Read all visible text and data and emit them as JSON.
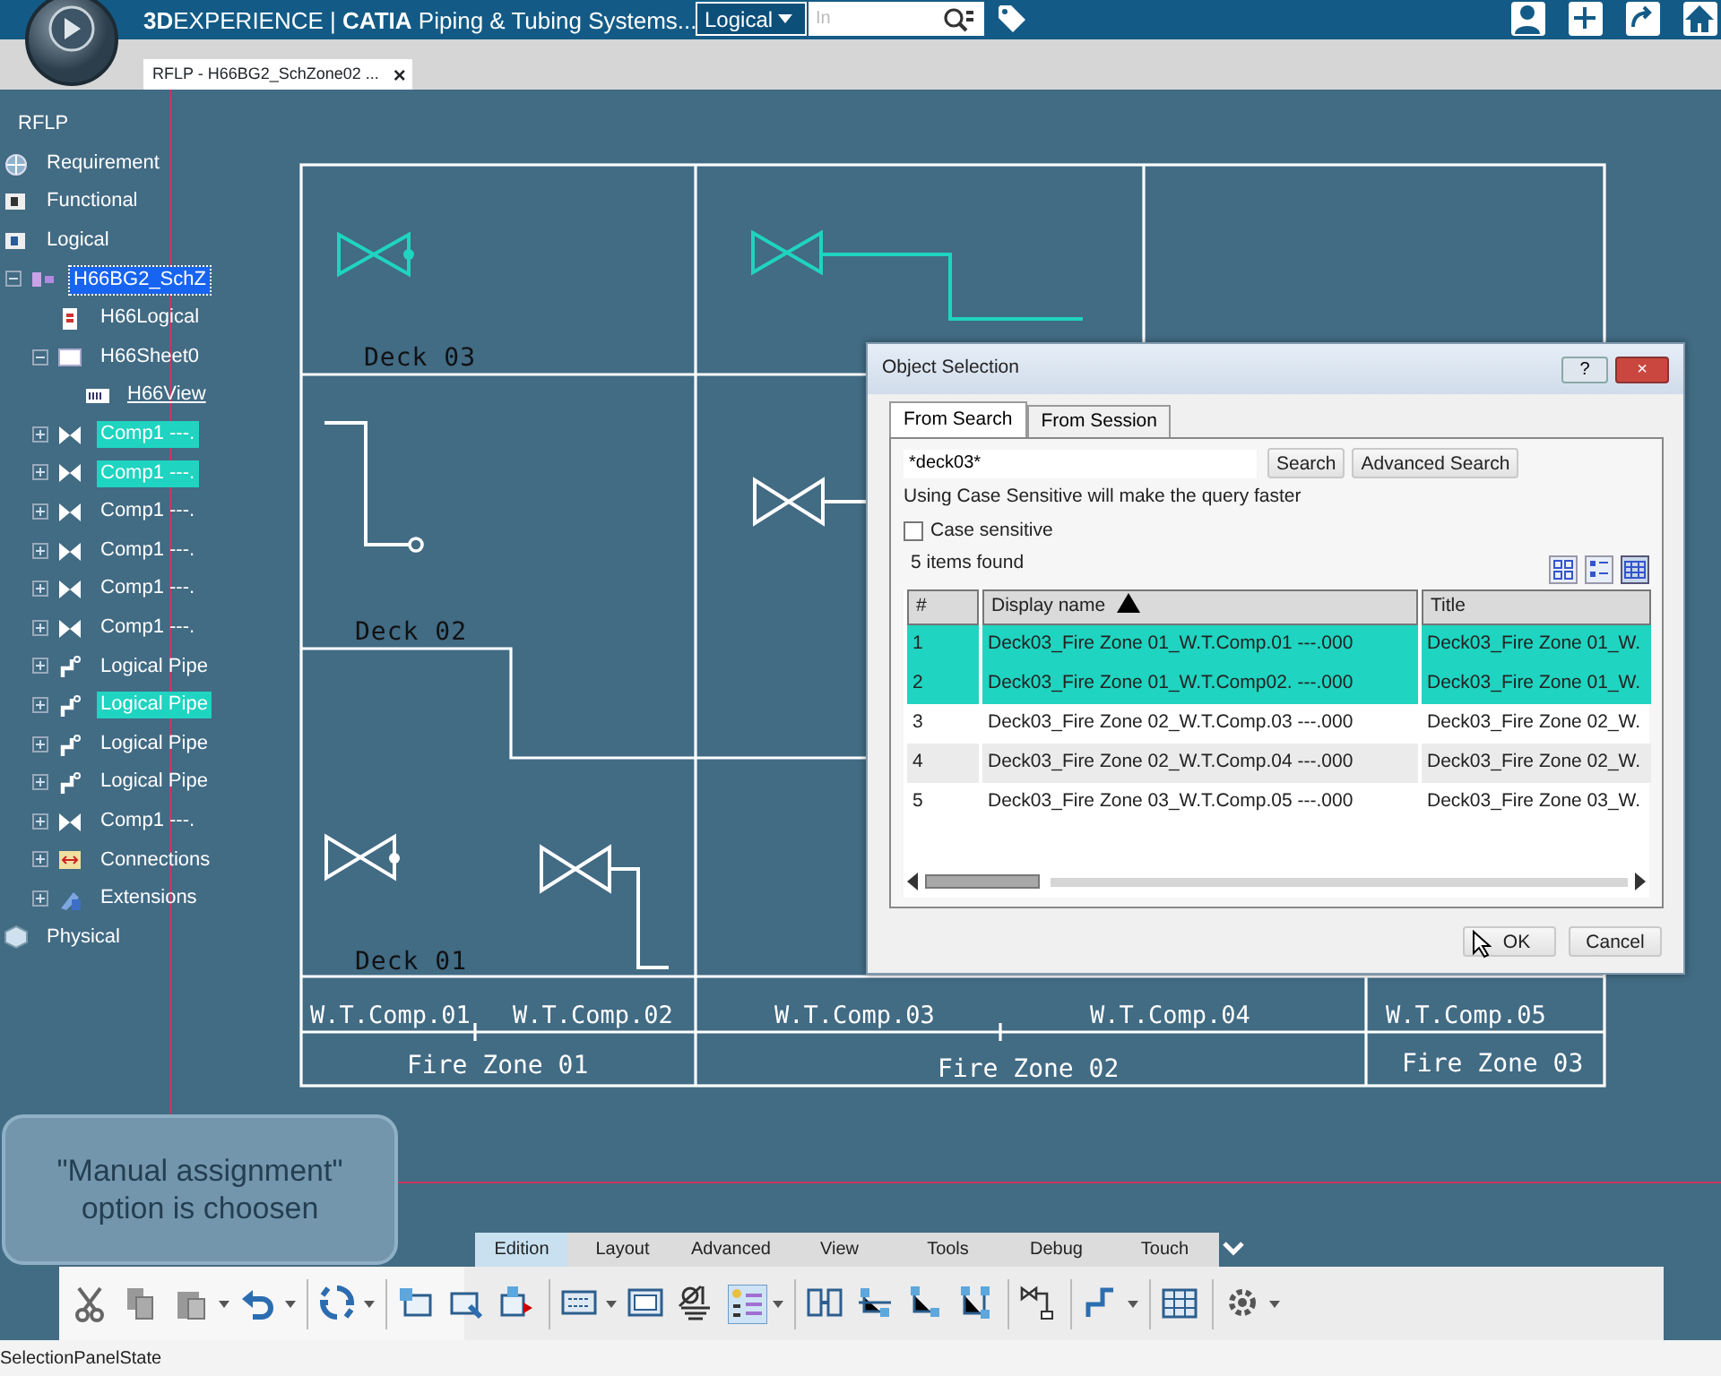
{
  "app_bar": {
    "brand": "**3D**EXPERIENCE | **CATIA** Piping & Tubing Systems...",
    "scope": "Logical",
    "search": {
      "placeholder": "In"
    }
  },
  "document_tab": {
    "label": "RFLP - H66BG2_SchZone02 ...",
    "close": "×"
  },
  "tree": [
    {
      "label": "RFLP",
      "selected": false,
      "highlighted": false,
      "children": [
        {
          "label": "Requirement",
          "kind": "requirement",
          "selected": false,
          "highlighted": false
        },
        {
          "label": "Functional",
          "kind": "functional",
          "selected": false,
          "highlighted": false
        },
        {
          "label": "Logical",
          "kind": "logical",
          "selected": false,
          "highlighted": false,
          "children": [
            {
              "label": "H66BG2_SchZ",
              "kind": "assembly",
              "selected": true,
              "highlighted": false,
              "expanded": true,
              "children": [
                {
                  "label": "H66Logical",
                  "kind": "document",
                  "selected": false,
                  "highlighted": false
                },
                {
                  "label": "H66Sheet0",
                  "kind": "sheet",
                  "selected": false,
                  "highlighted": false,
                  "expanded": true,
                  "children": [
                    {
                      "label": "H66View",
                      "kind": "view",
                      "selected": false,
                      "highlighted": false
                    }
                  ]
                },
                {
                  "label": "Comp1 ---.",
                  "kind": "valve",
                  "selected": false,
                  "highlighted": true,
                  "expanded": false
                },
                {
                  "label": "Comp1 ---.",
                  "kind": "valve",
                  "selected": false,
                  "highlighted": true,
                  "expanded": false
                },
                {
                  "label": "Comp1 ---.",
                  "kind": "valve",
                  "selected": false,
                  "highlighted": false,
                  "expanded": false
                },
                {
                  "label": "Comp1 ---.",
                  "kind": "valve",
                  "selected": false,
                  "highlighted": false,
                  "expanded": false
                },
                {
                  "label": "Comp1 ---.",
                  "kind": "valve",
                  "selected": false,
                  "highlighted": false,
                  "expanded": false
                },
                {
                  "label": "Comp1 ---.",
                  "kind": "valve",
                  "selected": false,
                  "highlighted": false,
                  "expanded": false
                },
                {
                  "label": "Logical Pipe",
                  "kind": "pipe",
                  "selected": false,
                  "highlighted": false,
                  "expanded": false
                },
                {
                  "label": "Logical Pipe",
                  "kind": "pipe",
                  "selected": false,
                  "highlighted": true,
                  "expanded": false
                },
                {
                  "label": "Logical Pipe",
                  "kind": "pipe",
                  "selected": false,
                  "highlighted": false,
                  "expanded": false
                },
                {
                  "label": "Logical Pipe",
                  "kind": "pipe",
                  "selected": false,
                  "highlighted": false,
                  "expanded": false
                },
                {
                  "label": "Comp1 ---.",
                  "kind": "valve",
                  "selected": false,
                  "highlighted": false,
                  "expanded": false
                },
                {
                  "label": "Connections",
                  "kind": "connections",
                  "selected": false,
                  "highlighted": false,
                  "expanded": false
                },
                {
                  "label": "Extensions",
                  "kind": "extensions",
                  "selected": false,
                  "highlighted": false,
                  "expanded": false
                }
              ]
            }
          ]
        },
        {
          "label": "Physical",
          "kind": "physical",
          "selected": false,
          "highlighted": false
        }
      ]
    }
  ],
  "drawing": {
    "decks": [
      "Deck 03",
      "Deck 02",
      "Deck 01"
    ],
    "compartments": [
      "W.T.Comp.01",
      "W.T.Comp.02",
      "W.T.Comp.03",
      "W.T.Comp.04",
      "W.T.Comp.05"
    ],
    "fire_zones": [
      "Fire Zone 01",
      "Fire Zone 02",
      "Fire Zone 03"
    ],
    "symbols": [
      {
        "highlighted": true
      },
      {
        "highlighted": true
      },
      {
        "highlighted": false
      },
      {
        "highlighted": false
      },
      {
        "highlighted": false
      },
      {
        "highlighted": false
      }
    ]
  },
  "dialog": {
    "title": "Object Selection",
    "help": "?",
    "close": "×",
    "tabs": [
      {
        "label": "From Search",
        "selected": true
      },
      {
        "label": "From Session",
        "selected": false
      }
    ],
    "query": "*deck03*",
    "buttons": [
      "Search",
      "Advanced Search"
    ],
    "hint": "Using Case Sensitive will make the query faster",
    "case_sensitive": {
      "label": "Case sensitive",
      "checked": false
    },
    "count": "5 items found",
    "view_modes": [
      {
        "selected": false
      },
      {
        "selected": false
      },
      {
        "selected": true
      }
    ],
    "table": {
      "columns": [
        "#",
        "Display name",
        "Title"
      ],
      "rows": [
        {
          "cells": [
            "1",
            "Deck03_Fire Zone 01_W.T.Comp.01 ---.000",
            "Deck03_Fire Zone 01_W."
          ],
          "selected": true
        },
        {
          "cells": [
            "2",
            "Deck03_Fire Zone 01_W.T.Comp02. ---.000",
            "Deck03_Fire Zone 01_W."
          ],
          "selected": true
        },
        {
          "cells": [
            "3",
            "Deck03_Fire Zone 02_W.T.Comp.03 ---.000",
            "Deck03_Fire Zone 02_W."
          ],
          "selected": false
        },
        {
          "cells": [
            "4",
            "Deck03_Fire Zone 02_W.T.Comp.04 ---.000",
            "Deck03_Fire Zone 02_W."
          ],
          "selected": false
        },
        {
          "cells": [
            "5",
            "Deck03_Fire Zone 03_W.T.Comp.05 ---.000",
            "Deck03_Fire Zone 03_W."
          ],
          "selected": false
        }
      ]
    },
    "ok": "OK",
    "cancel": "Cancel"
  },
  "hint_bubble": "\"Manual assignment\" option is choosen",
  "toolbar": {
    "tabs": [
      {
        "label": "Edition",
        "selected": true
      },
      {
        "label": "Layout",
        "selected": false
      },
      {
        "label": "Advanced",
        "selected": false
      },
      {
        "label": "View",
        "selected": false
      },
      {
        "label": "Tools",
        "selected": false
      },
      {
        "label": "Debug",
        "selected": false
      },
      {
        "label": "Touch",
        "selected": false
      }
    ]
  },
  "status_bar": "SelectionPanelState"
}
